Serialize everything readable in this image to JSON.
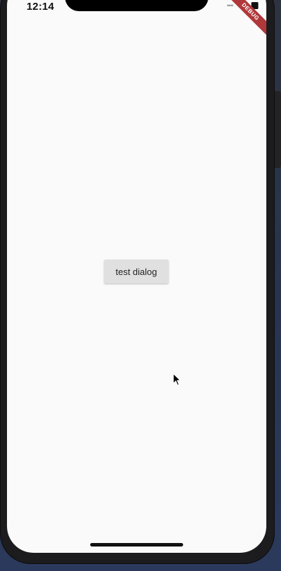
{
  "status_bar": {
    "time": "12:14",
    "signal": "••••"
  },
  "debug_banner": "DEBUG",
  "main": {
    "button_label": "test dialog"
  },
  "colors": {
    "screen_background": "#fafafa",
    "button_background": "#e0e0e0",
    "debug_banner": "#b0383b"
  }
}
